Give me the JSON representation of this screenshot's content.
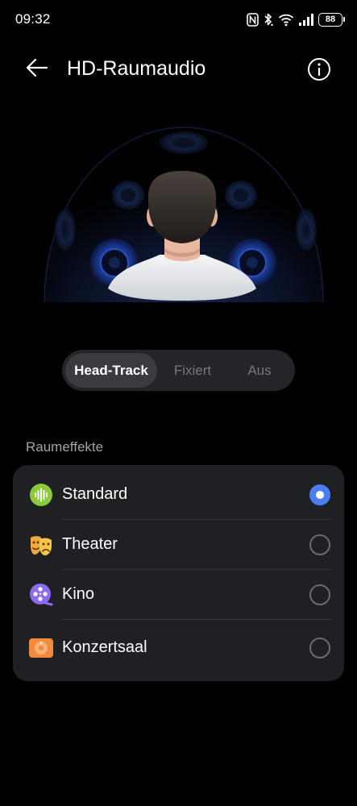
{
  "status_bar": {
    "time": "09:32",
    "battery_level": "88",
    "icons": [
      "nfc-icon",
      "bluetooth-icon",
      "wifi-icon",
      "signal-icon",
      "battery-icon"
    ]
  },
  "header": {
    "title": "HD-Raumaudio",
    "back_icon": "arrow-left-icon",
    "info_icon": "info-icon"
  },
  "mode_selector": {
    "options": [
      "Head-Track",
      "Fixiert",
      "Aus"
    ],
    "selected": "Head-Track"
  },
  "effects": {
    "section_title": "Raumeffekte",
    "items": [
      {
        "label": "Standard",
        "icon": "sound-wave-icon",
        "selected": true
      },
      {
        "label": "Theater",
        "icon": "theater-masks-icon",
        "selected": false
      },
      {
        "label": "Kino",
        "icon": "film-reel-icon",
        "selected": false
      },
      {
        "label": "Konzertsaal",
        "icon": "concert-hall-icon",
        "selected": false
      }
    ]
  },
  "colors": {
    "background": "#000000",
    "card": "#1f2023",
    "accent": "#4b7cf0",
    "segment_background": "#242528",
    "segment_active": "#3a3b3f"
  }
}
